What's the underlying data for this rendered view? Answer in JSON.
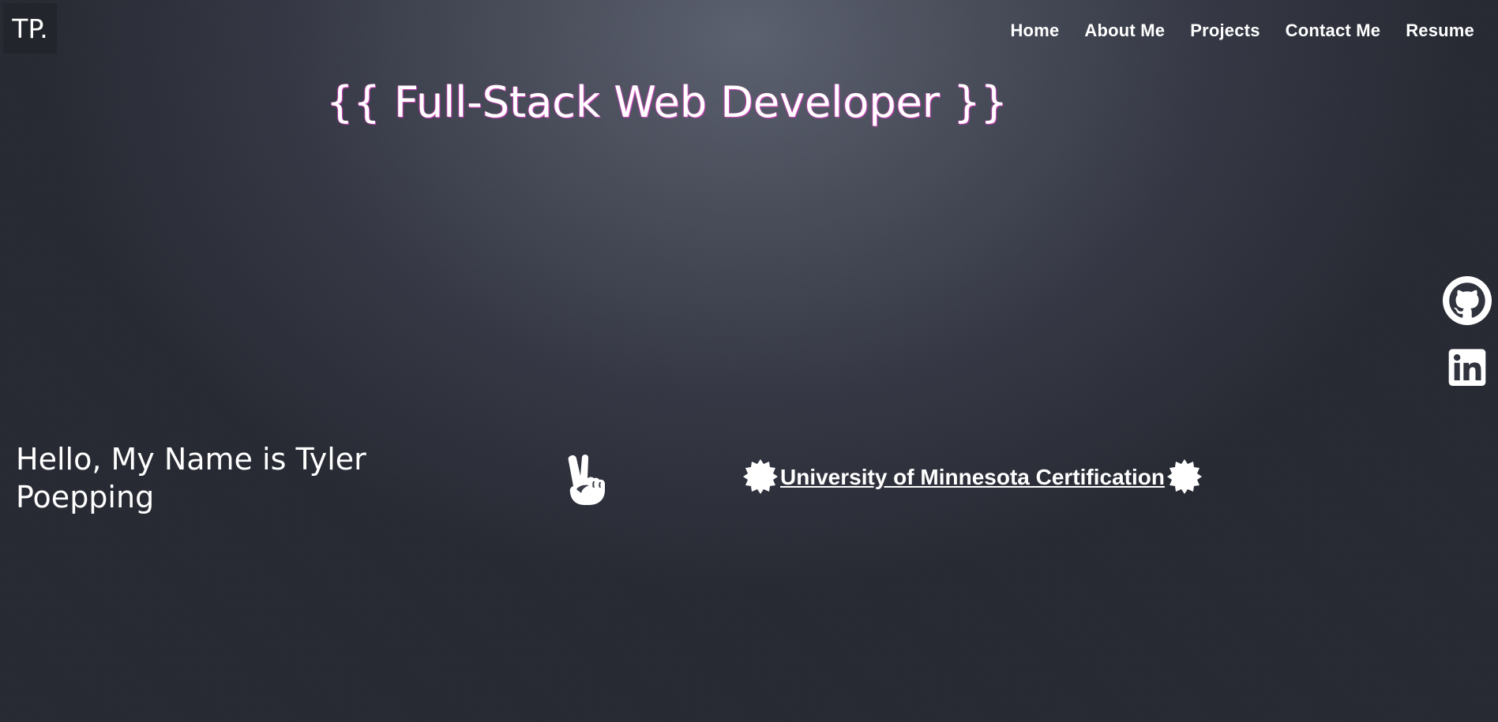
{
  "logo": {
    "text": "TP."
  },
  "nav": {
    "items": [
      {
        "label": "Home"
      },
      {
        "label": "About Me"
      },
      {
        "label": "Projects"
      },
      {
        "label": "Contact Me"
      },
      {
        "label": "Resume"
      }
    ]
  },
  "hero": {
    "headline": "{{ Full-Stack Web Developer }}",
    "greeting": "Hello, My Name is Tyler Poepping",
    "greeting_icon": "peace-hand-icon"
  },
  "certification": {
    "label": "University of Minnesota Certification",
    "icon": "badge-icon"
  },
  "social": {
    "icons": [
      "github-icon",
      "linkedin-icon"
    ]
  },
  "colors": {
    "text": "#ffffff",
    "headline_glow": "#e048c8",
    "background_center": "#5c6170",
    "background_edge": "#272a33"
  }
}
